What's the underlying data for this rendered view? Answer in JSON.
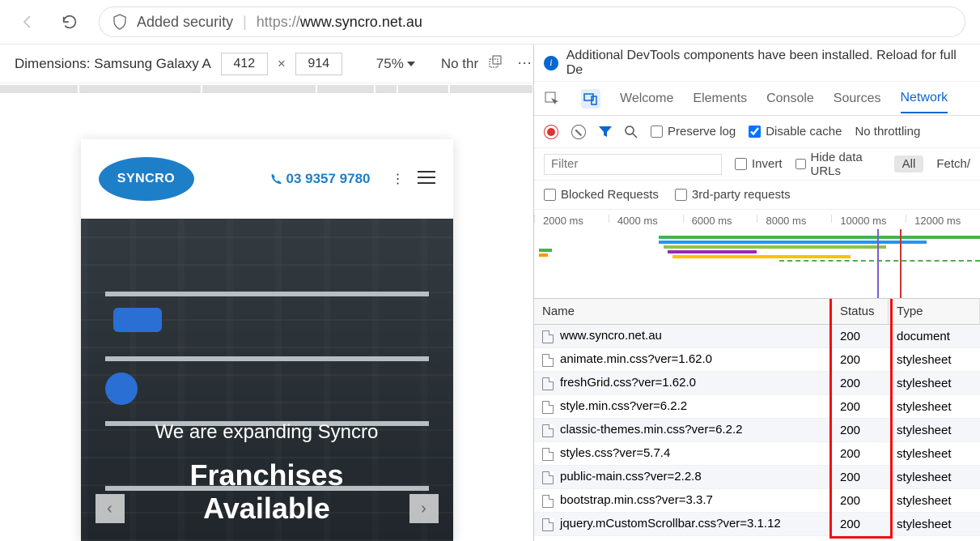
{
  "browser": {
    "security_label": "Added security",
    "url_proto": "https://",
    "url_host": "www.syncro.net.au"
  },
  "device_toolbar": {
    "label": "Dimensions: Samsung Galaxy A",
    "width": "412",
    "height": "914",
    "zoom": "75%",
    "throttling": "No thr"
  },
  "site": {
    "logo_text": "SYNCRO",
    "phone": "03 9357 9780",
    "hero_line1": "We are expanding Syncro",
    "hero_line2a": "Franchises",
    "hero_line2b": "Available"
  },
  "devtools": {
    "info_message": "Additional DevTools components have been installed. Reload for full De",
    "tabs": [
      "Welcome",
      "Elements",
      "Console",
      "Sources",
      "Network"
    ],
    "active_tab": "Network",
    "preserve_log": "Preserve log",
    "disable_cache": "Disable cache",
    "throttle": "No throttling",
    "filter_placeholder": "Filter",
    "invert": "Invert",
    "hide_data": "Hide data URLs",
    "all_pill": "All",
    "fetch_label": "Fetch/",
    "blocked": "Blocked Requests",
    "thirdparty": "3rd-party requests",
    "ticks": [
      "2000 ms",
      "4000 ms",
      "6000 ms",
      "8000 ms",
      "10000 ms",
      "12000 ms"
    ],
    "columns": {
      "name": "Name",
      "status": "Status",
      "type": "Type"
    },
    "rows": [
      {
        "name": "www.syncro.net.au",
        "status": "200",
        "type": "document"
      },
      {
        "name": "animate.min.css?ver=1.62.0",
        "status": "200",
        "type": "stylesheet"
      },
      {
        "name": "freshGrid.css?ver=1.62.0",
        "status": "200",
        "type": "stylesheet"
      },
      {
        "name": "style.min.css?ver=6.2.2",
        "status": "200",
        "type": "stylesheet"
      },
      {
        "name": "classic-themes.min.css?ver=6.2.2",
        "status": "200",
        "type": "stylesheet"
      },
      {
        "name": "styles.css?ver=5.7.4",
        "status": "200",
        "type": "stylesheet"
      },
      {
        "name": "public-main.css?ver=2.2.8",
        "status": "200",
        "type": "stylesheet"
      },
      {
        "name": "bootstrap.min.css?ver=3.3.7",
        "status": "200",
        "type": "stylesheet"
      },
      {
        "name": "jquery.mCustomScrollbar.css?ver=3.1.12",
        "status": "200",
        "type": "stylesheet"
      }
    ]
  }
}
